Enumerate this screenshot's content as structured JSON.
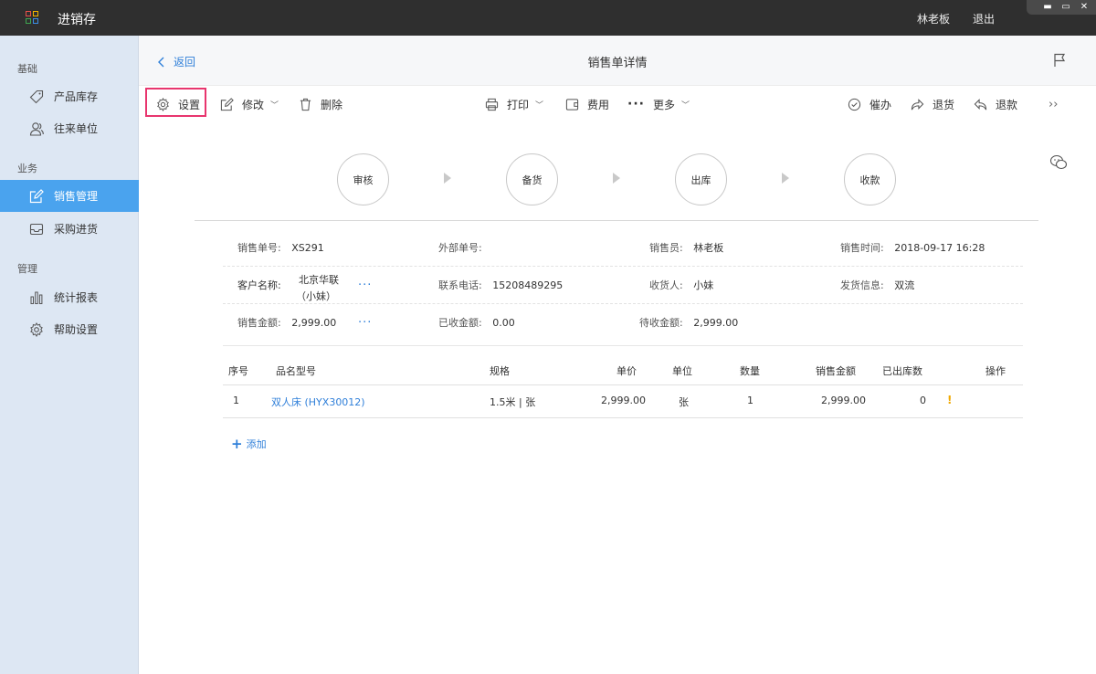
{
  "app": {
    "title": "进销存",
    "user": "林老板",
    "logout": "退出",
    "window_controls": [
      "minimize",
      "maximize",
      "close"
    ]
  },
  "sidebar": {
    "sections": [
      "基础",
      "业务",
      "管理"
    ],
    "items": [
      {
        "label": "产品库存",
        "icon": "tag-icon"
      },
      {
        "label": "往来单位",
        "icon": "contacts-icon"
      },
      {
        "label": "销售管理",
        "icon": "edit-icon",
        "active": true
      },
      {
        "label": "采购进货",
        "icon": "inbox-icon"
      },
      {
        "label": "统计报表",
        "icon": "bar-chart-icon"
      },
      {
        "label": "帮助设置",
        "icon": "gear-icon"
      }
    ]
  },
  "header": {
    "back_label": "返回",
    "title": "销售单详情"
  },
  "toolbar": {
    "settings": "设置",
    "edit": "修改",
    "delete": "删除",
    "print": "打印",
    "fee": "费用",
    "more": "更多",
    "urge": "催办",
    "return_goods": "退货",
    "refund": "退款"
  },
  "workflow": {
    "steps": [
      "审核",
      "备货",
      "出库",
      "收款"
    ]
  },
  "order": {
    "sales_no_label": "销售单号:",
    "sales_no": "XS291",
    "external_no_label": "外部单号:",
    "external_no": "",
    "salesperson_label": "销售员:",
    "salesperson": "林老板",
    "sales_time_label": "销售时间:",
    "sales_time": "2018-09-17 16:28",
    "customer_label": "客户名称:",
    "customer_line1": "北京华联",
    "customer_line2": "（小妹）",
    "phone_label": "联系电话:",
    "phone": "15208489295",
    "receiver_label": "收货人:",
    "receiver": "小妹",
    "shipping_label": "发货信息:",
    "shipping": "双流",
    "amount_label": "销售金额:",
    "amount": "2,999.00",
    "received_label": "已收金额:",
    "received": "0.00",
    "pending_label": "待收金额:",
    "pending": "2,999.00",
    "more_dots": "···"
  },
  "table": {
    "headers": [
      "序号",
      "品名型号",
      "规格",
      "单价",
      "单位",
      "数量",
      "销售金额",
      "已出库数",
      "操作"
    ],
    "rows": [
      {
        "no": "1",
        "product": "双人床 (HYX30012)",
        "spec": "1.5米 | 张",
        "price": "2,999.00",
        "unit": "张",
        "qty": "1",
        "amount": "2,999.00",
        "shipped": "0",
        "action": "!"
      }
    ],
    "add_label": "添加"
  },
  "colors": {
    "accent": "#4aa3ee",
    "link": "#2f7fd9",
    "titlebar": "#2f2f2f",
    "sidebar": "#dde7f3",
    "highlight": "#e8356e",
    "warning": "#f0a800"
  }
}
